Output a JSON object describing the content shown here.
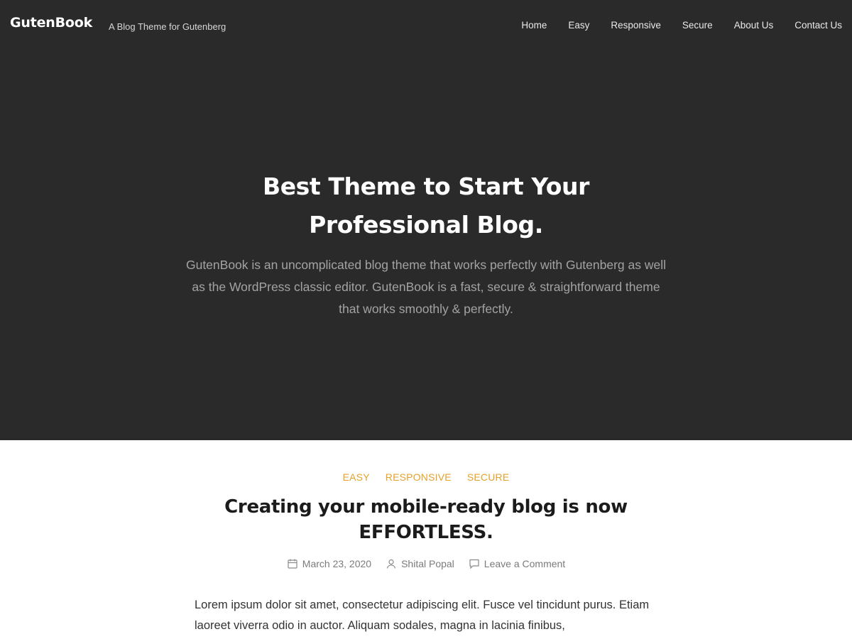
{
  "site": {
    "title": "GutenBook",
    "tagline": "A Blog Theme for Gutenberg"
  },
  "nav": {
    "items": [
      {
        "label": "Home"
      },
      {
        "label": "Easy"
      },
      {
        "label": "Responsive"
      },
      {
        "label": "Secure"
      },
      {
        "label": "About Us"
      },
      {
        "label": "Contact Us"
      }
    ]
  },
  "hero": {
    "title": "Best Theme to Start Your Professional Blog.",
    "text": "GutenBook is an uncomplicated blog theme that works perfectly with Gutenberg as well as the WordPress classic editor. GutenBook is a fast, secure & straightforward theme that works smoothly & perfectly."
  },
  "post": {
    "categories": [
      "EASY",
      "RESPONSIVE",
      "SECURE"
    ],
    "title": "Creating your mobile-ready blog is now EFFORTLESS.",
    "meta": {
      "date": "March 23, 2020",
      "author": "Shital Popal",
      "comments": "Leave a Comment",
      "icons": {
        "date": "calendar-icon",
        "author": "user-icon",
        "comments": "comment-icon"
      }
    },
    "excerpt": "Lorem ipsum dolor sit amet, consectetur adipiscing elit. Fusce vel tincidunt purus. Etiam laoreet viverra odio in auctor. Aliquam sodales, magna in lacinia finibus,"
  },
  "colors": {
    "hero_background": "#2a2a2a",
    "accent": "#e6a12a",
    "heading": "#1b1b1b",
    "meta_text": "#7b7b7b"
  }
}
